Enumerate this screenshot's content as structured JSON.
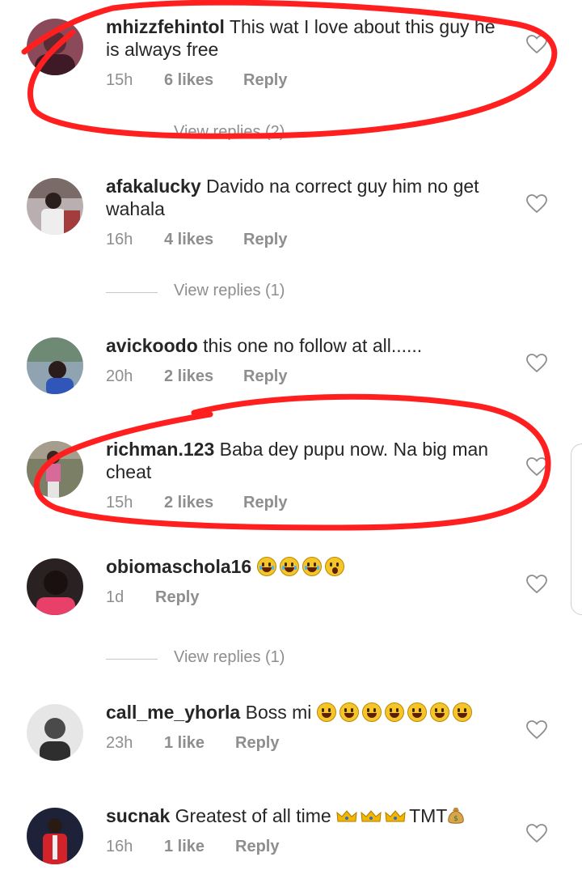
{
  "comments": [
    {
      "username": "mhizzfehintol",
      "text": "This wat I love about this guy he is always free",
      "time": "15h",
      "likes": "6 likes",
      "reply": "Reply",
      "avatar_color": "#8b4a5a",
      "view_replies": "View replies (2)"
    },
    {
      "username": "afakalucky",
      "text": "Davido na correct guy him no get wahala",
      "time": "16h",
      "likes": "4 likes",
      "reply": "Reply",
      "avatar_color": "#6b6a75",
      "view_replies": "View replies (1)"
    },
    {
      "username": "avickoodo",
      "text": "this one no follow at all......",
      "time": "20h",
      "likes": "2 likes",
      "reply": "Reply",
      "avatar_color": "#4b6b80",
      "view_replies": ""
    },
    {
      "username": "richman.123",
      "text": "Baba dey pupu now. Na big man cheat",
      "time": "15h",
      "likes": "2 likes",
      "reply": "Reply",
      "avatar_color": "#8a6e5e",
      "view_replies": ""
    },
    {
      "username": "obiomaschola16",
      "text": "",
      "time": "1d",
      "likes": "",
      "reply": "Reply",
      "avatar_color": "#3a2a2a",
      "emojis": [
        "face-with-tears-of-joy",
        "face-with-tears-of-joy",
        "face-with-tears-of-joy",
        "face-with-open-mouth"
      ],
      "view_replies": "View replies (1)"
    },
    {
      "username": "call_me_yhorla",
      "text": "Boss mi",
      "time": "23h",
      "likes": "1 like",
      "reply": "Reply",
      "avatar_color": "#9a9a9a",
      "emojis": [
        "grinning-face",
        "grinning-face",
        "grinning-face",
        "grinning-face",
        "grinning-face",
        "grinning-face",
        "grinning-face"
      ],
      "view_replies": ""
    },
    {
      "username": "sucnak",
      "text": "Greatest of all time",
      "text_suffix": "TMT",
      "time": "16h",
      "likes": "1 like",
      "reply": "Reply",
      "avatar_color": "#2a2f45",
      "emojis": [
        "crown",
        "crown",
        "crown"
      ],
      "suffix_emoji": "money-bag",
      "view_replies": ""
    }
  ],
  "colors": {
    "primary_text": "#262626",
    "secondary_text": "#8e8e8e",
    "annotation_red": "#ff1f1f"
  },
  "icons": {
    "like": "heart-outline-icon"
  }
}
